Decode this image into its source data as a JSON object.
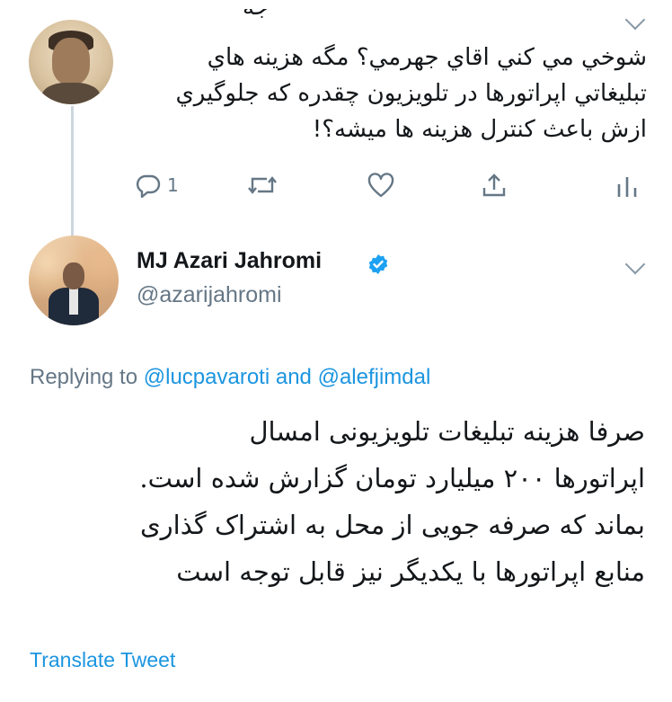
{
  "parent_tweet": {
    "name_cutoff": "جه",
    "text": "شوخي مي کني اقاي جهرمي؟ مگه هزينه هاي تبليغاتي اپراتورها در تلويزيون چقدره که جلوگيري ازش باعث کنترل هزينه ها ميشه؟!",
    "reply_count": "1",
    "icons": {
      "reply": "reply-icon",
      "retweet": "retweet-icon",
      "like": "heart-icon",
      "share": "share-icon",
      "stats": "analytics-icon",
      "more": "chevron-down-icon"
    }
  },
  "main_tweet": {
    "display_name": "MJ Azari Jahromi",
    "handle": "@azarijahromi",
    "replying_prefix": "Replying to",
    "mention_1": "@lucpavaroti",
    "and_word": "and",
    "mention_2": "@alefjimdal",
    "text_lines": [
      "صرفا هزینه تبلیغات تلویزیونی امسال",
      "اپراتورها ۲۰۰ میلیارد تومان گزارش شده است.",
      "بماند که صرفه جویی از محل به اشتراک گذاری",
      "منابع اپراتورها با یکدیگر نیز قابل توجه است"
    ],
    "translate_label": "Translate Tweet"
  },
  "colors": {
    "text": "#14171a",
    "secondary": "#657786",
    "link": "#1b95e0",
    "verified": "#1da1f2",
    "thread_line": "#ccd6dd"
  }
}
